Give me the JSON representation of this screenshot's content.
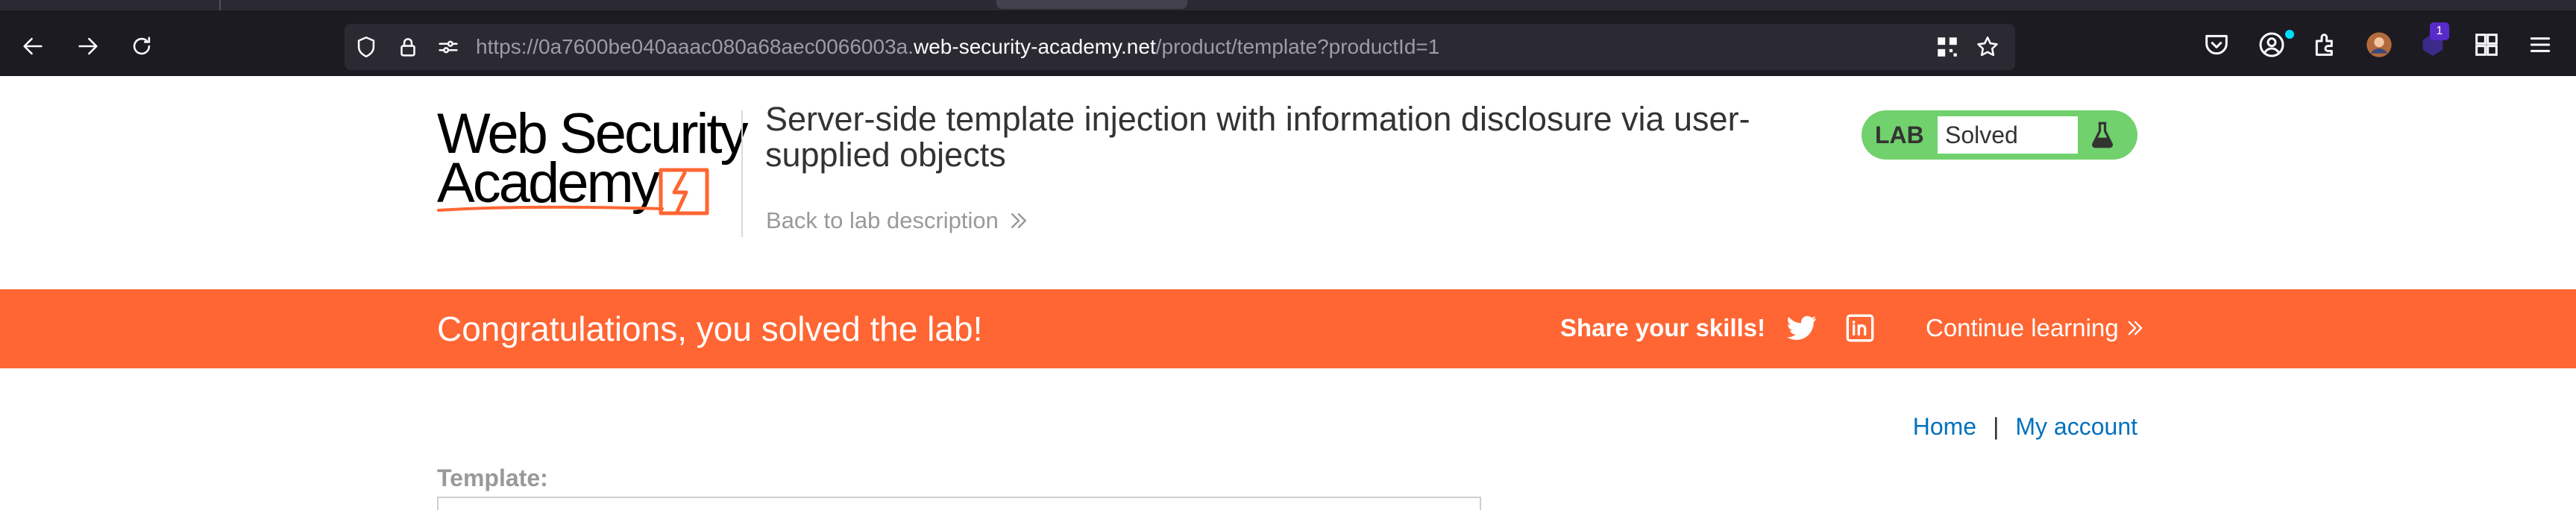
{
  "browser": {
    "url_prefix": "https://0a7600be040aaac080a68aec0066003a.",
    "url_host": "web-security-academy.net",
    "url_path": "/product/template?productId=1",
    "extension_badge": "1",
    "icons": [
      "back-arrow-icon",
      "forward-arrow-icon",
      "reload-icon",
      "shield-icon",
      "lock-icon",
      "permissions-icon",
      "qr-code-icon",
      "bookmark-star-icon",
      "pocket-icon",
      "account-icon",
      "extensions-icon",
      "avatar-extension-icon",
      "badge-extension-icon",
      "puzzle-icon",
      "hamburger-menu-icon"
    ]
  },
  "header": {
    "logo_line1": "Web Security",
    "logo_line2": "Academy",
    "lab_title": "Server-side template injection with information disclosure via user-supplied objects",
    "back_link": "Back to lab description",
    "lab_badge": "LAB",
    "lab_status": "Solved"
  },
  "banner": {
    "message": "Congratulations, you solved the lab!",
    "share_label": "Share your skills!",
    "continue_label": "Continue learning",
    "icons": [
      "twitter-icon",
      "linkedin-icon"
    ]
  },
  "nav": {
    "home": "Home",
    "separator": "|",
    "my_account": "My account"
  },
  "form": {
    "template_label": "Template:"
  },
  "colors": {
    "browser_bg": "#1c1b22",
    "urlbar_bg": "#2b2a33",
    "lab_green": "#70d16d",
    "banner_orange": "#ff6633",
    "link_blue": "#0071bc",
    "title_text": "#333332",
    "muted_text": "#999999"
  }
}
